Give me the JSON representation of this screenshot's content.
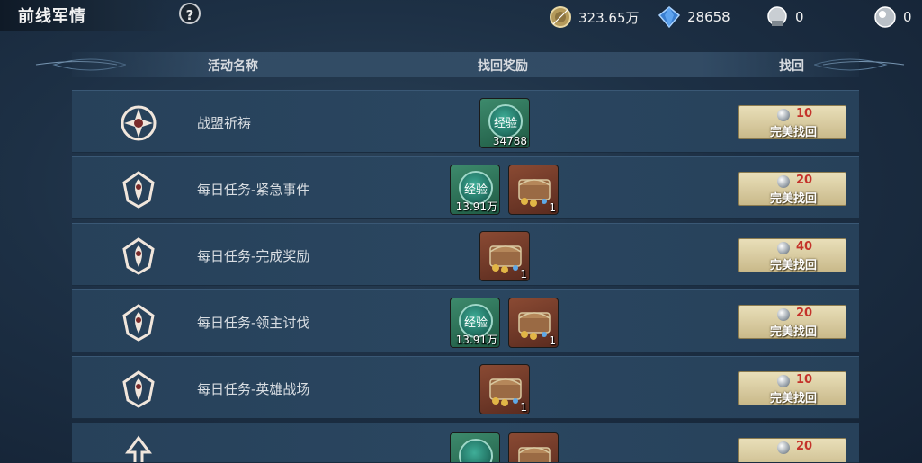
{
  "header": {
    "title": "前线军情",
    "help_label": "?",
    "resources": [
      {
        "icon": "gold-coin-icon",
        "value": "323.65万"
      },
      {
        "icon": "blue-diamond-icon",
        "value": "28658"
      },
      {
        "icon": "silver-coin-icon",
        "value": "0"
      },
      {
        "icon": "silver-orb-icon",
        "value": "0"
      }
    ]
  },
  "table": {
    "columns": [
      "活动名称",
      "找回奖励",
      "找回"
    ],
    "rows": [
      {
        "emblem": "alliance-emblem-icon",
        "name": "战盟祈祷",
        "rewards": [
          {
            "type": "exp",
            "label": "经验",
            "qty": "34788"
          }
        ],
        "cost": "10",
        "button": "完美找回"
      },
      {
        "emblem": "daily-task-emblem-icon",
        "name": "每日任务-紧急事件",
        "rewards": [
          {
            "type": "exp",
            "label": "经验",
            "qty": "13.91万"
          },
          {
            "type": "chest",
            "qty": "1"
          }
        ],
        "cost": "20",
        "button": "完美找回"
      },
      {
        "emblem": "daily-task-emblem-icon",
        "name": "每日任务-完成奖励",
        "rewards": [
          {
            "type": "chest",
            "qty": "1"
          }
        ],
        "cost": "40",
        "button": "完美找回"
      },
      {
        "emblem": "daily-task-emblem-icon",
        "name": "每日任务-领主讨伐",
        "rewards": [
          {
            "type": "exp",
            "label": "经验",
            "qty": "13.91万"
          },
          {
            "type": "chest",
            "qty": "1"
          }
        ],
        "cost": "20",
        "button": "完美找回"
      },
      {
        "emblem": "daily-task-emblem-icon",
        "name": "每日任务-英雄战场",
        "rewards": [
          {
            "type": "chest",
            "qty": "1"
          }
        ],
        "cost": "10",
        "button": "完美找回"
      },
      {
        "emblem": "arrow-emblem-icon",
        "name": "",
        "rewards": [
          {
            "type": "exp",
            "label": "",
            "qty": ""
          },
          {
            "type": "chest",
            "qty": ""
          }
        ],
        "cost": "20",
        "button": ""
      }
    ]
  },
  "colors": {
    "accent_gold": "#d8c99a",
    "cost_red": "#c4322a",
    "exp_green": "#2f7d63",
    "chest_brown": "#6e3a28"
  }
}
